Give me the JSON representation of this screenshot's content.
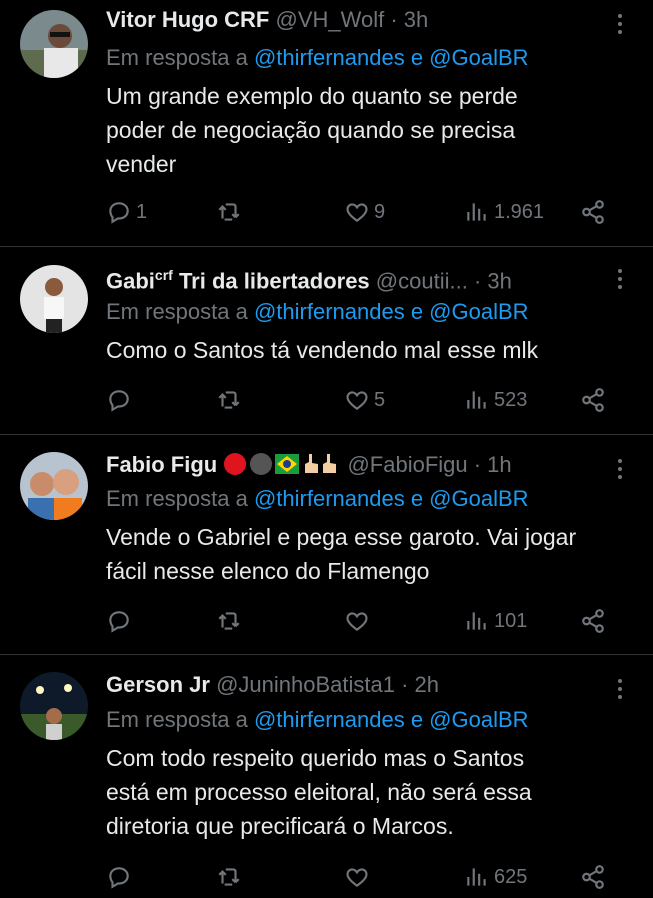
{
  "replying_prefix": "Em resposta a",
  "tweets": [
    {
      "name": "Vitor Hugo CRF",
      "handle_time": "@VH_Wolf · 3h",
      "mentions": "@thirfernandes e @GoalBR",
      "body_lines": [
        "Um grande exemplo do quanto se perde",
        "poder de negociação quando se precisa",
        "vender"
      ],
      "replies": "1",
      "retweets": "",
      "likes": "9",
      "views": "1.961"
    },
    {
      "name": "Gabi",
      "name_sup": "crf",
      "name_suffix": "Tri da libertadores",
      "handle_time": "@coutii... · 3h",
      "mentions": "@thirfernandes e @GoalBR",
      "body_lines": [
        "Como o Santos tá vendendo mal esse mlk"
      ],
      "replies": "",
      "retweets": "",
      "likes": "5",
      "views": "523"
    },
    {
      "name": "Fabio Figu",
      "handle_time": "@FabioFigu · 1h",
      "mentions": "@thirfernandes e @GoalBR",
      "body_lines": [
        "Vende o Gabriel e pega esse garoto. Vai jogar",
        "fácil nesse elenco do Flamengo"
      ],
      "replies": "",
      "retweets": "",
      "likes": "",
      "views": "101"
    },
    {
      "name": "Gerson Jr",
      "handle_time": "@JuninhoBatista1 · 2h",
      "mentions": "@thirfernandes e @GoalBR",
      "body_lines": [
        "Com todo respeito querido mas o Santos",
        "está em processo eleitoral, não será essa",
        "diretoria que precificará o Marcos."
      ],
      "replies": "",
      "retweets": "",
      "likes": "",
      "views": "625"
    }
  ],
  "colors": {
    "text": "#e7e9ea",
    "muted": "#71767b",
    "link": "#1d9bf0",
    "divider": "#2f3336"
  }
}
